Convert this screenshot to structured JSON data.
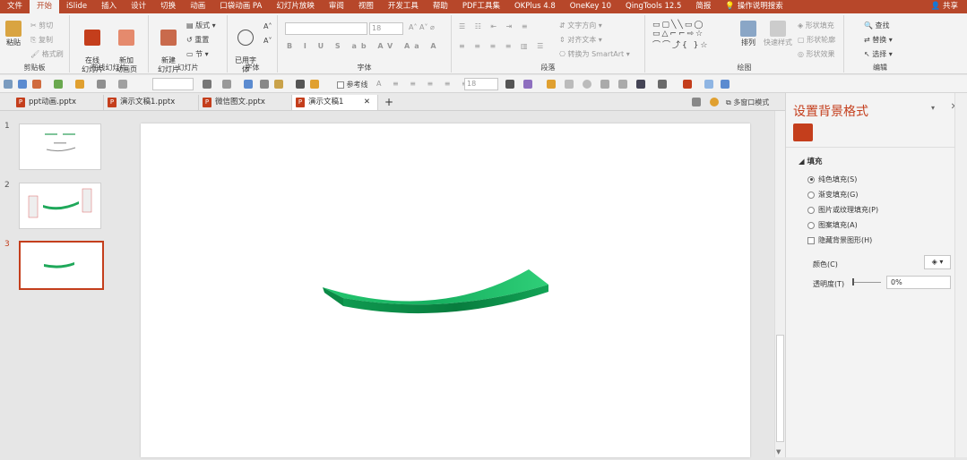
{
  "menu": {
    "items": [
      "文件",
      "开始",
      "iSlide",
      "插入",
      "设计",
      "切换",
      "动画",
      "口袋动画 PA",
      "幻灯片放映",
      "审阅",
      "视图",
      "开发工具",
      "帮助",
      "PDF工具集",
      "OKPlus 4.8",
      "OneKey 10",
      "QingTools 12.5",
      "简报",
      "操作说明搜索"
    ],
    "share": "共享"
  },
  "ribbon": {
    "clipboard": {
      "paste": "粘贴",
      "cut": "剪切",
      "copy": "复制",
      "format_painter": "格式刷",
      "label": "剪贴板"
    },
    "online": {
      "online_slides": "在线\n幻灯片",
      "new_anim": "新加\n动画页",
      "label": "在线幻灯片"
    },
    "slides": {
      "new_slide": "新建\n幻灯片",
      "layout": "版式",
      "reset": "重置",
      "section": "节",
      "label": "幻灯片"
    },
    "fonts": {
      "common": "已用字\n体",
      "label": "字体"
    },
    "font": {
      "size": "18",
      "label": "字体"
    },
    "paragraph": {
      "text_dir": "文字方向",
      "align_text": "对齐文本",
      "smartart": "转换为 SmartArt",
      "label": "段落"
    },
    "drawing": {
      "arrange": "排列",
      "quick_styles": "快速样式",
      "shape_fill": "形状填充",
      "shape_outline": "形状轮廓",
      "shape_effects": "形状效果",
      "label": "绘图"
    },
    "editing": {
      "find": "查找",
      "replace": "替换",
      "select": "选择",
      "label": "编辑"
    }
  },
  "qat": {
    "gridlines": "参考线",
    "size": "18"
  },
  "tabs": [
    {
      "label": "ppt动画.pptx"
    },
    {
      "label": "演示文稿1.pptx"
    },
    {
      "label": "微信图文.pptx"
    },
    {
      "label": "演示文稿1"
    }
  ],
  "multi_window": "多窗口模式",
  "thumbs": [
    "1",
    "2",
    "3"
  ],
  "pane": {
    "title": "设置背景格式",
    "section": "填充",
    "opt_solid": "纯色填充(S)",
    "opt_gradient": "渐变填充(G)",
    "opt_picture": "图片或纹理填充(P)",
    "opt_pattern": "图案填充(A)",
    "opt_hide": "隐藏背景图形(H)",
    "color_label": "颜色(C)",
    "transparency_label": "透明度(T)",
    "transparency_value": "0%"
  },
  "colors": {
    "accent": "#b7472a",
    "shape_top": "#1fbf6a",
    "shape_side": "#0e9a4d"
  }
}
